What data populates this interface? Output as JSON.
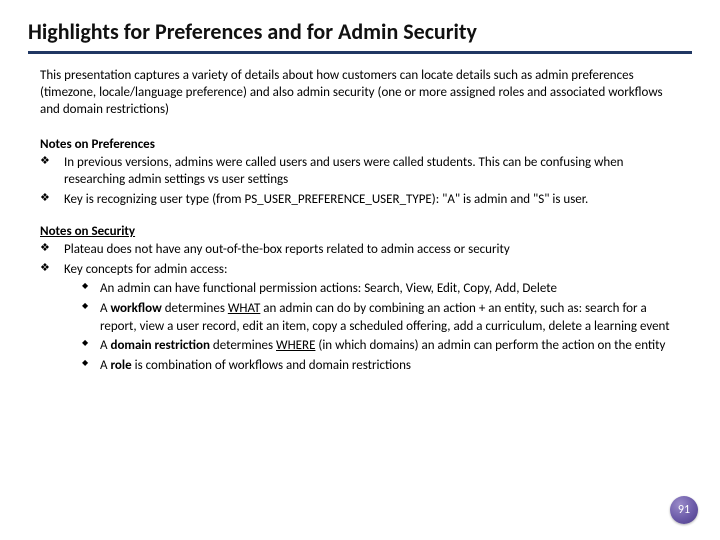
{
  "title": "Highlights for Preferences and for Admin Security",
  "intro": "This presentation captures a variety of details about how customers can locate details such as admin preferences (timezone, locale/language preference) and also admin security (one or more assigned roles and associated workflows and domain restrictions)",
  "prefs": {
    "heading": "Notes on Preferences",
    "items": [
      "In previous versions, admins were called users and users were called students. This can be confusing when researching admin settings vs user settings",
      "Key is recognizing user type (from PS_USER_PREFERENCE_USER_TYPE): \"A\" is admin and \"S\" is user."
    ]
  },
  "security": {
    "heading": "Notes on Security",
    "items": [
      "Plateau does not have any out-of-the-box reports related to admin access or security",
      "Key concepts for admin access:"
    ],
    "sub": {
      "a": {
        "pre": "An admin can have functional permission actions:  Search, View, Edit, Copy, Add, Delete"
      },
      "b": {
        "pre": "A ",
        "bold": "workflow",
        "mid": " determines ",
        "u": "WHAT",
        "post": " an admin can do by combining an action + an entity, such as: search for a report, view a user record, edit an item, copy a scheduled offering, add a curriculum, delete a learning event"
      },
      "c": {
        "pre": "A ",
        "bold": "domain restriction",
        "mid": " determines ",
        "u": "WHERE",
        "post": " (in which domains) an admin can perform the action on the entity"
      },
      "d": {
        "pre": "A ",
        "bold": "role",
        "post": " is combination of workflows and domain restrictions"
      }
    }
  },
  "page": "91"
}
